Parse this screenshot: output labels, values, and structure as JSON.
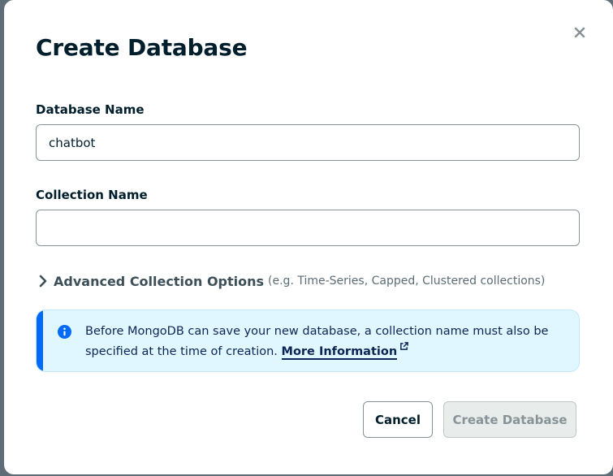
{
  "dialog": {
    "title": "Create Database",
    "close_icon": "close-icon"
  },
  "database_name": {
    "label": "Database Name",
    "value": "chatbot",
    "placeholder": ""
  },
  "collection_name": {
    "label": "Collection Name",
    "value": "",
    "placeholder": ""
  },
  "advanced_options": {
    "icon": "chevron-right-icon",
    "title": "Advanced Collection Options",
    "hint": "(e.g. Time-Series, Capped, Clustered collections)"
  },
  "info_banner": {
    "icon": "info-icon",
    "text": "Before MongoDB can save your new database, a collection name must also be specified at the time of creation.",
    "link_label": "More Information",
    "link_icon": "external-link-icon"
  },
  "footer": {
    "cancel_label": "Cancel",
    "create_label": "Create Database",
    "create_disabled": true
  },
  "colors": {
    "title": "#001e2b",
    "banner_background": "#e1f7ff",
    "banner_accent": "#016bf8",
    "disabled_button": "#e8edeb"
  }
}
